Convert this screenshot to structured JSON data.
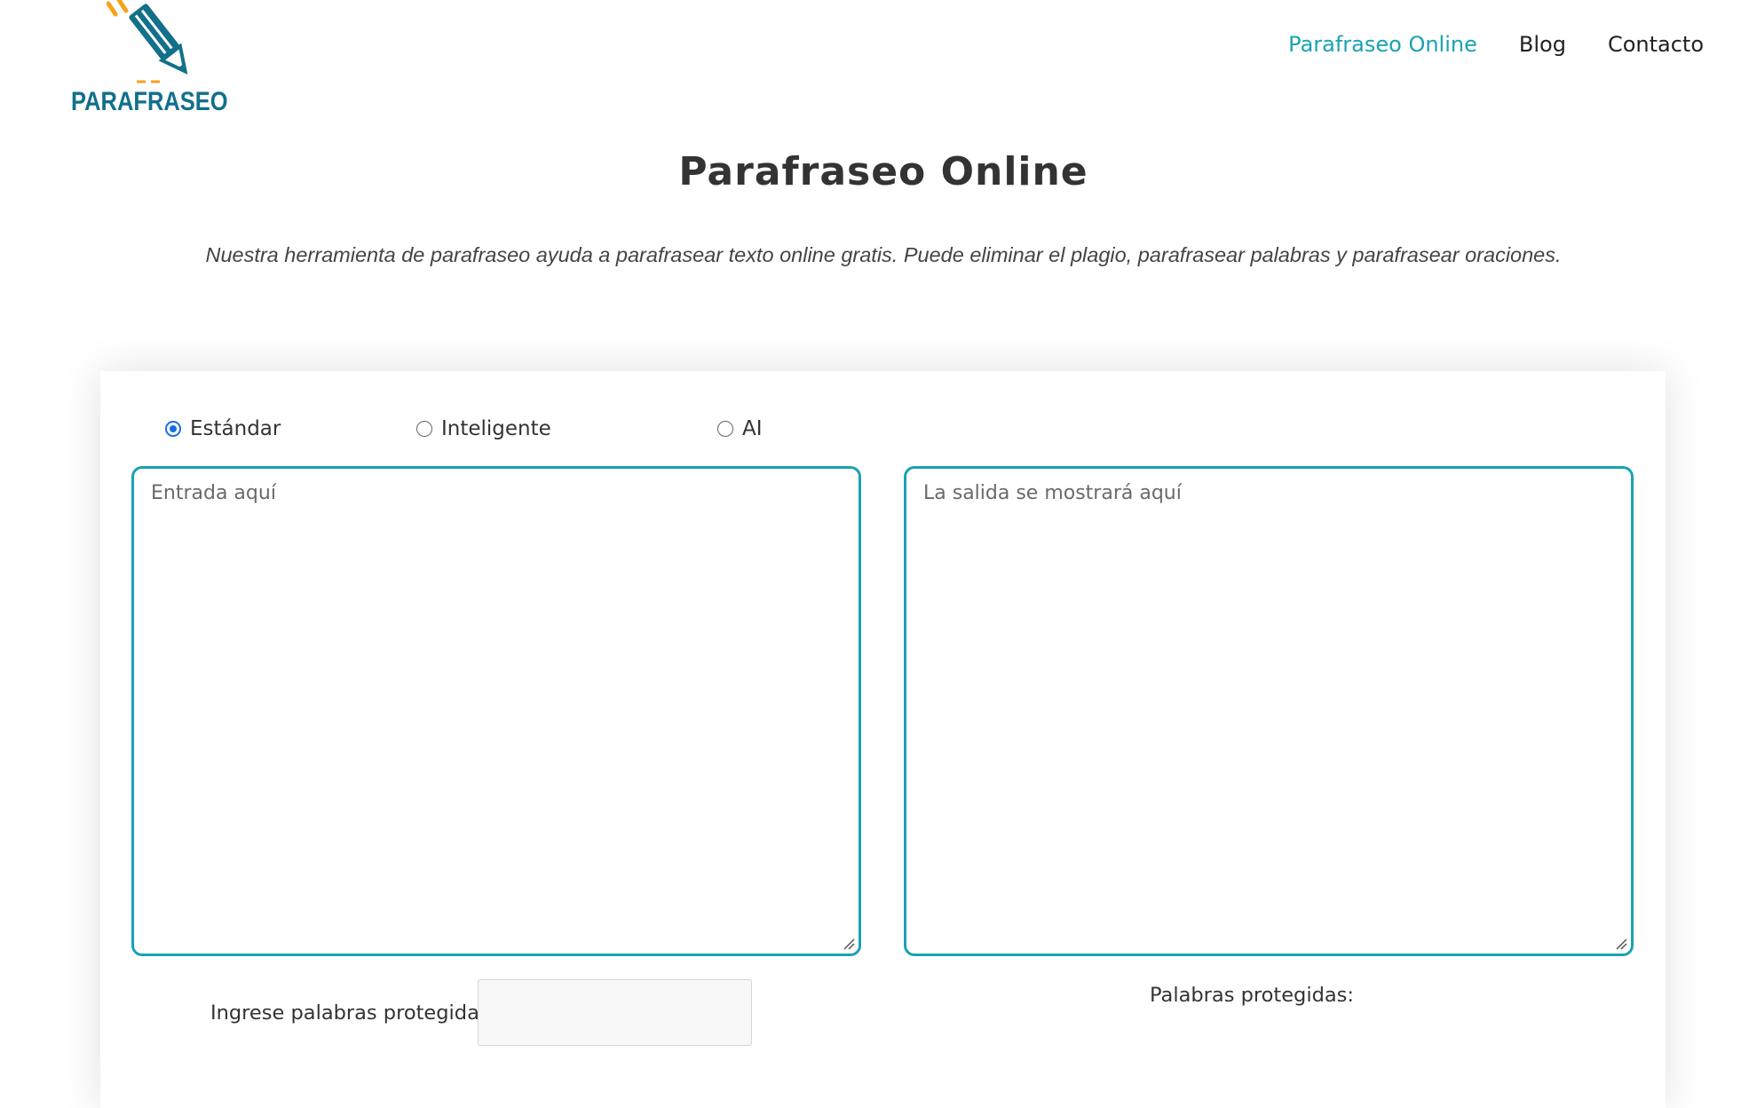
{
  "logo": {
    "text": "PARAFRASEO"
  },
  "nav": [
    {
      "label": "Parafraseo Online",
      "active": true
    },
    {
      "label": "Blog",
      "active": false
    },
    {
      "label": "Contacto",
      "active": false
    }
  ],
  "page": {
    "title": "Parafraseo Online",
    "description": "Nuestra herramienta de parafraseo ayuda a parafrasear texto online gratis. Puede eliminar el plagio, parafrasear palabras y parafrasear oraciones."
  },
  "modes": [
    {
      "label": "Estándar",
      "selected": true
    },
    {
      "label": "Inteligente",
      "selected": false
    },
    {
      "label": "AI",
      "selected": false
    }
  ],
  "input": {
    "placeholder": "Entrada aquí"
  },
  "output": {
    "placeholder": "La salida se mostrará aquí"
  },
  "protected": {
    "input_label": "Ingrese palabras protegidas:",
    "list_label": "Palabras protegidas:"
  },
  "colors": {
    "accent": "#19a2b3",
    "brand": "#12708a",
    "logo_orange": "#f7a21b",
    "radio": "#1a6fe0"
  }
}
